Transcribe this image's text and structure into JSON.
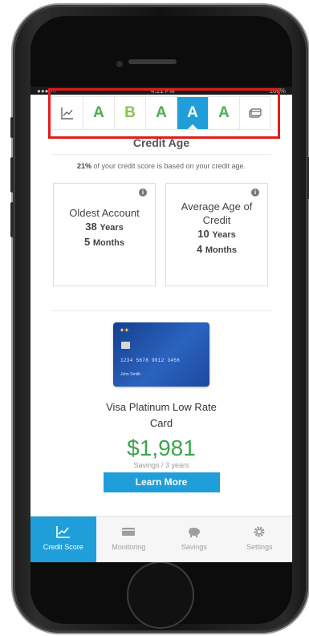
{
  "status_bar": {
    "time": "4:21 PM",
    "battery": "100%"
  },
  "grade_tabs": [
    {
      "kind": "icon",
      "icon": "trend-chart-icon"
    },
    {
      "kind": "grade",
      "label": "A"
    },
    {
      "kind": "grade",
      "label": "B"
    },
    {
      "kind": "grade",
      "label": "A"
    },
    {
      "kind": "grade",
      "label": "A",
      "selected": true
    },
    {
      "kind": "grade",
      "label": "A"
    },
    {
      "kind": "icon",
      "icon": "credit-cards-icon"
    }
  ],
  "section": {
    "title": "Credit Age",
    "desc_percent": "21%",
    "desc_text": " of your credit score is based on your credit age."
  },
  "stats": {
    "oldest": {
      "label": "Oldest Account",
      "years": "38",
      "years_unit": "Years",
      "months": "5",
      "months_unit": "Months"
    },
    "average": {
      "label_line1": "Average Age of",
      "label_line2": "Credit",
      "years": "10",
      "years_unit": "Years",
      "months": "4",
      "months_unit": "Months"
    }
  },
  "offer": {
    "card_brand": "Visa Platinum Low Rate",
    "card_number": "1234 5678 9012 3456",
    "card_holder": "John Smith",
    "title_line1": "Visa Platinum Low Rate",
    "title_line2": "Card",
    "savings_amount": "$1,981",
    "savings_caption": "Savings / 3 years",
    "button_label": "Learn More"
  },
  "nav": [
    {
      "label": "Credit Score",
      "icon": "chart-icon",
      "active": true
    },
    {
      "label": "Monitoring",
      "icon": "monitor-icon"
    },
    {
      "label": "Savings",
      "icon": "piggy-bank-icon"
    },
    {
      "label": "Settings",
      "icon": "gear-icon"
    }
  ],
  "colors": {
    "accent": "#1f9ed9",
    "grade_a": "#4caf50",
    "grade_b": "#8bc34a",
    "highlight": "#e21b1b",
    "savings": "#3aa64b"
  }
}
